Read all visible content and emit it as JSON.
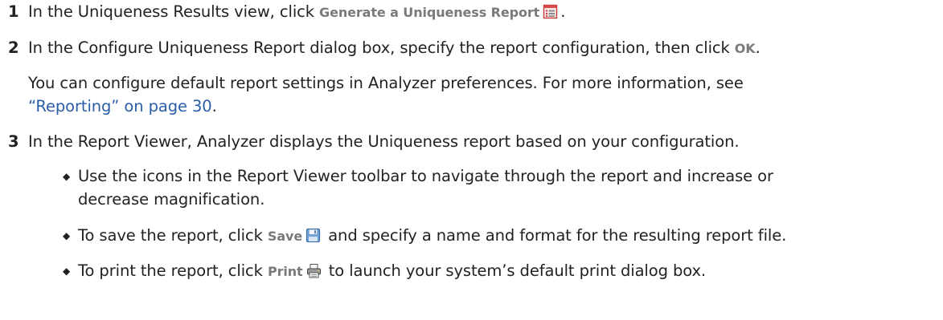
{
  "steps": [
    {
      "number": "1",
      "prefix": "In the Uniqueness Results view, click ",
      "ui_label": "Generate a Uniqueness Report",
      "icon": "report-icon",
      "suffix": "."
    },
    {
      "number": "2",
      "prefix": "In the Configure Uniqueness Report dialog box, specify the report configuration, then click ",
      "ui_label": "OK",
      "suffix": ".",
      "note_line1": "You can configure default report settings in Analyzer preferences. For more information, see",
      "note_link": "“Reporting” on page 30",
      "note_end": "."
    },
    {
      "number": "3",
      "text": "In the Report Viewer, Analyzer displays the Uniqueness report based on your configuration.",
      "bullets": [
        {
          "line1": "Use the icons in the Report Viewer toolbar to navigate through the report and increase or",
          "line2": "decrease magnification."
        },
        {
          "prefix": "To save the report, click ",
          "ui_label": "Save",
          "icon": "save-icon",
          "suffix": " and specify a name and format for the resulting report file."
        },
        {
          "prefix": "To print the report, click ",
          "ui_label": "Print",
          "icon": "print-icon",
          "suffix": " to launch your system’s default print dialog box."
        }
      ]
    }
  ],
  "colors": {
    "text": "#222222",
    "ui_label": "#7a7a7a",
    "link": "#2a5ea8"
  }
}
